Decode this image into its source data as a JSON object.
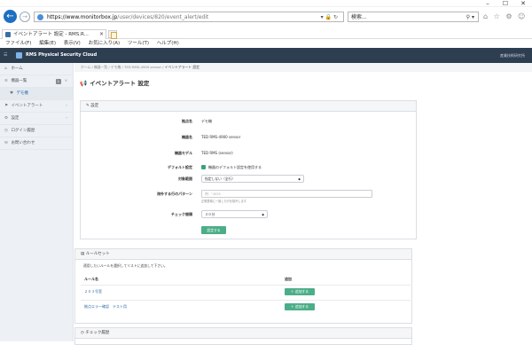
{
  "window": {
    "minimize": "–",
    "maximize": "☐",
    "close": "✕"
  },
  "browser": {
    "url_host": "https://www.monitorbox.jp",
    "url_path": "/user/devices/820/event_alert/edit",
    "url_icons": "▾ 🔒 ↻",
    "search_placeholder": "検索...",
    "search_icon": "⚲ ▾",
    "tool_icons": "⌂ ☆ ⚙ ☺",
    "tab_title": "イベントアラート 設定 - RMS.R...",
    "tab_close": "×",
    "back": "←",
    "forward": "→"
  },
  "menubar": [
    "ファイル(F)",
    "編集(E)",
    "表示(V)",
    "お気に入り(A)",
    "ツール(T)",
    "ヘルプ(H)"
  ],
  "navbar": {
    "hamburger": "☰",
    "brand": "RMS Physical Security Cloud",
    "org": "産業技術研究所"
  },
  "sidebar": {
    "home": {
      "icon": "⌂",
      "label": "ホーム"
    },
    "devices": {
      "icon": "≡",
      "label": "機器一覧",
      "badge": "1",
      "chev": "∨"
    },
    "device_sub": {
      "icon": "♥",
      "label": "デモ機"
    },
    "alerts": {
      "icon": "⚑",
      "label": "イベントアラート",
      "chev": "›"
    },
    "settings": {
      "icon": "⚙",
      "label": "設定",
      "chev": "›"
    },
    "login_history": {
      "icon": "◷",
      "label": "ログイン履歴"
    },
    "contact": {
      "icon": "✉",
      "label": "お問い合わせ"
    }
  },
  "breadcrumb": [
    "ホーム",
    "機器一覧",
    "デモ機",
    "TED RMS-4900 sensor",
    "イベントアラート 設定"
  ],
  "breadcrumb_sep": "/",
  "page": {
    "icon": "📢",
    "title": "イベントアラート 設定"
  },
  "settings_panel": {
    "header_icon": "✎",
    "header": "設定",
    "fields": {
      "location_label": "拠点名",
      "location": "デモ機",
      "device_label": "機器名",
      "device": "TED RMS-4900 sensor",
      "model_label": "機器モデル",
      "model": "TED RMS (sensor)",
      "default_label": "デフォルト設定",
      "default_text": "機器のデフォルト設定を使用する",
      "target_label": "対象範囲",
      "target_value": "指定しない（全行）",
      "target_caret": "◆",
      "pattern_label": "除外する行のパターン",
      "pattern_placeholder": "例: ^DOS",
      "pattern_help": "正規表現に一致した行を除外します",
      "interval_label": "チェック間隔",
      "interval_value": "３０分",
      "interval_caret": "◆"
    },
    "save": "設定する"
  },
  "rules_panel": {
    "header_icon": "▤",
    "header": "ルールセット",
    "description": "適用したいルールを選択してリストに追加して下さい。",
    "col_name": "ルール名",
    "col_action": "追加",
    "rows": [
      {
        "name": "２０３号室",
        "action": "＋ 追加する"
      },
      {
        "name": "拠点エラー確認　テスト用",
        "action": "＋ 追加する"
      }
    ]
  },
  "history_panel": {
    "header_icon": "◷",
    "header": "チェック履歴"
  }
}
